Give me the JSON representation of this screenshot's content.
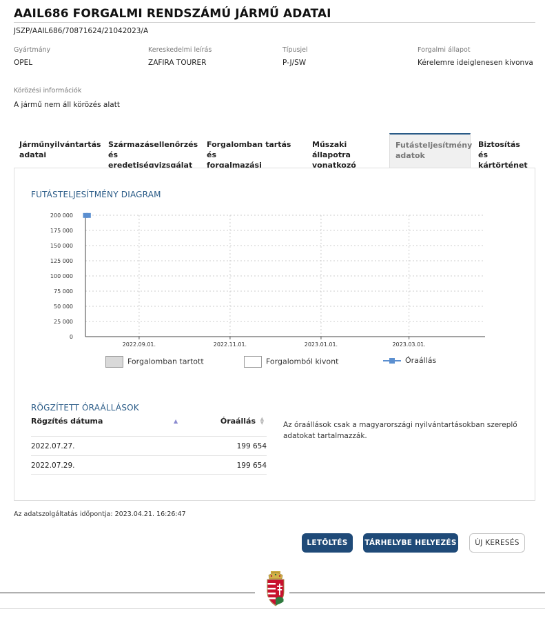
{
  "header": {
    "title": "AAIL686 FORGALMI RENDSZÁMÚ JÁRMŰ ADATAI",
    "id": "JSZP/AAIL686/70871624/21042023/A"
  },
  "fields": [
    {
      "label": "Gyártmány",
      "value": "OPEL"
    },
    {
      "label": "Kereskedelmi leírás",
      "value": "ZAFIRA TOURER"
    },
    {
      "label": "Típusjel",
      "value": "P-J/SW"
    },
    {
      "label": "Forgalmi állapot",
      "value": "Kérelemre ideiglenesen kivonva"
    }
  ],
  "wanted": {
    "label": "Körözési információk",
    "value": "A jármű nem áll körözés alatt"
  },
  "tabs": [
    {
      "line1": "Járműnyilvántartás",
      "line2": "adatai"
    },
    {
      "line1": "Származásellenőrzés",
      "line2": "és eredetiségvizsgálat"
    },
    {
      "line1": "Forgalomban tartás és",
      "line2": "forgalmazási korlátozás"
    },
    {
      "line1": "Műszaki állapotra",
      "line2": "vonatkozó adatok"
    },
    {
      "line1": "Futásteljesítmény",
      "line2": "adatok"
    },
    {
      "line1": "Biztosítás és",
      "line2": "kártörténet"
    }
  ],
  "active_tab": 4,
  "chart_section_title": "FUTÁSTELJESÍTMÉNY DIAGRAM",
  "chart_data": {
    "type": "line",
    "y_ticks": [
      "200 000",
      "175 000",
      "150 000",
      "125 000",
      "100 000",
      "75 000",
      "50 000",
      "25 000",
      "0"
    ],
    "ylim": [
      0,
      200000
    ],
    "x_ticks": [
      "2022.09.01.",
      "2022.11.01.",
      "2023.01.01.",
      "2023.03.01."
    ],
    "xlim": [
      "2022.07.27.",
      "2023.04.21."
    ],
    "grid": true,
    "series": [
      {
        "name": "Óraállás",
        "color": "#5b8fd0",
        "x": [
          "2022.07.27.",
          "2022.07.29."
        ],
        "y": [
          199654,
          199654
        ]
      }
    ],
    "legend": [
      {
        "label": "Forgalomban tartott",
        "swatch": "#d9d9d9"
      },
      {
        "label": "Forgalomból kivont",
        "swatch": "#ffffff"
      },
      {
        "label": "Óraállás",
        "swatch": "#5b8fd0"
      }
    ]
  },
  "records_title": "RÖGZÍTETT ÓRAÁLLÁSOK",
  "records": {
    "headers": [
      "Rögzítés dátuma",
      "Óraállás"
    ],
    "rows": [
      {
        "date": "2022.07.27.",
        "value": "199 654"
      },
      {
        "date": "2022.07.29.",
        "value": "199 654"
      }
    ]
  },
  "note": "Az óraállások csak a magyarországi nyilvántartásokban szereplő adatokat tartalmazzák.",
  "footer": {
    "time_label": "Az adatszolgáltatás időpontja:",
    "time_value": "2023.04.21. 16:26:47"
  },
  "buttons": {
    "download": "LETÖLTÉS",
    "store": "TÁRHELYBE HELYEZÉS",
    "new_search": "ÚJ KERESÉS"
  },
  "colors": {
    "primary": "#1f4a78",
    "accent": "#2a5b87",
    "series": "#5b8fd0"
  }
}
